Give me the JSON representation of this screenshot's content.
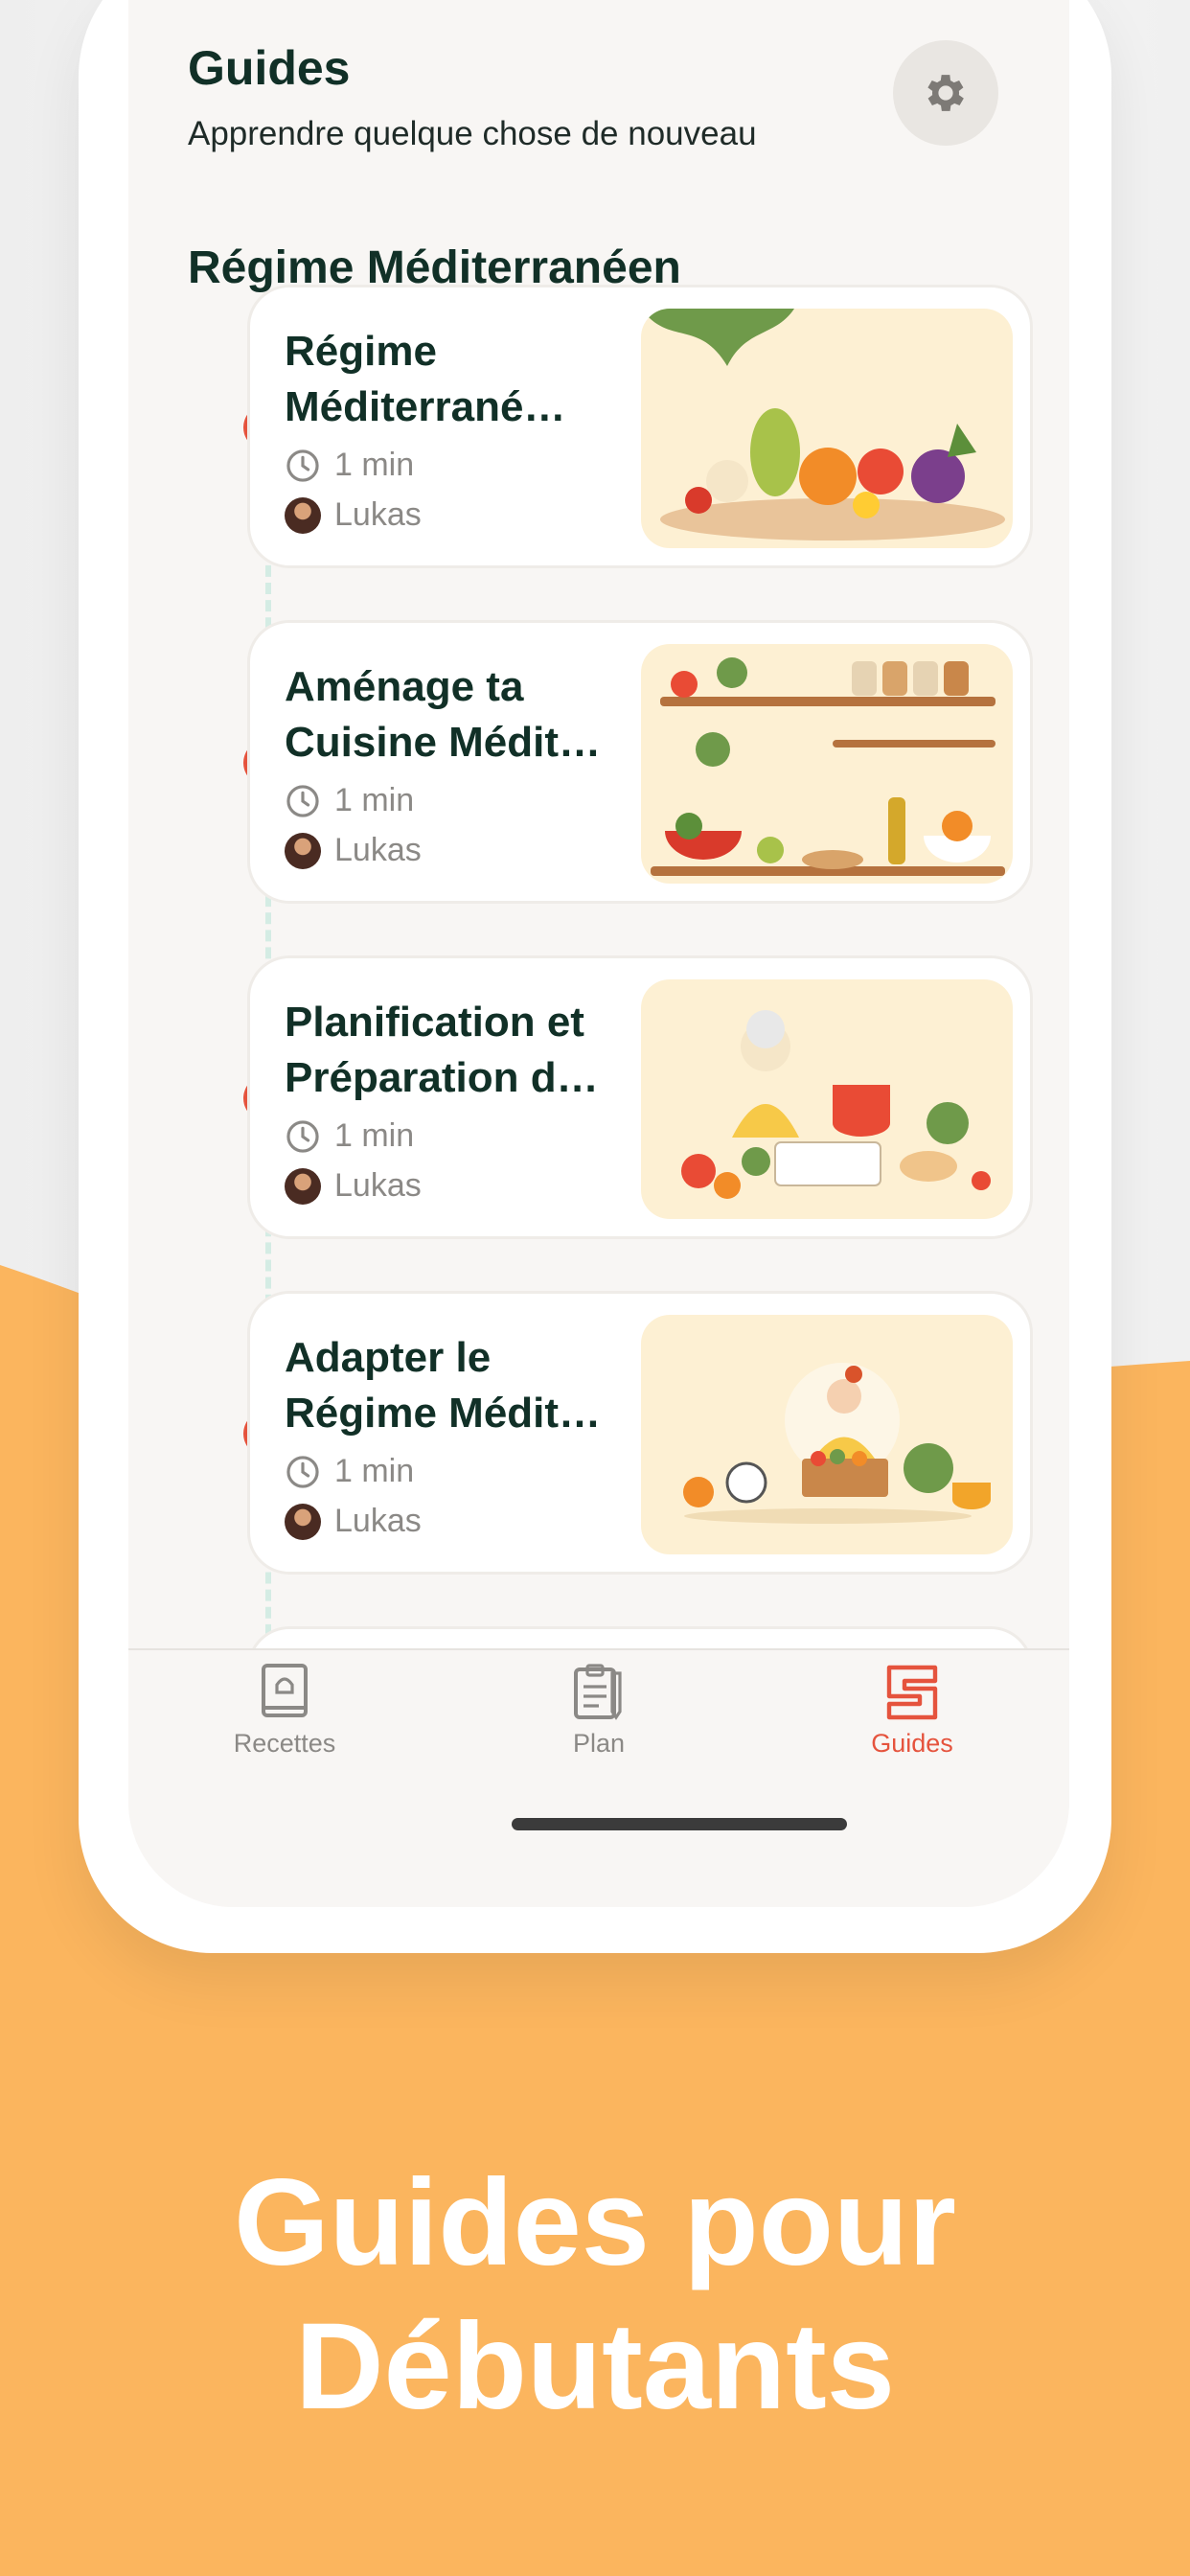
{
  "header": {
    "title": "Guides",
    "subtitle": "Apprendre quelque chose de nouveau"
  },
  "section": {
    "title": "Régime Méditerranéen"
  },
  "cards": [
    {
      "title_line1": "Régime",
      "title_line2": "Méditerrané…",
      "duration": "1 min",
      "author": "Lukas",
      "completed": true
    },
    {
      "title_line1": "Aménage ta",
      "title_line2": "Cuisine Médit…",
      "duration": "1 min",
      "author": "Lukas",
      "completed": true
    },
    {
      "title_line1": "Planification et",
      "title_line2": "Préparation d…",
      "duration": "1 min",
      "author": "Lukas",
      "completed": true
    },
    {
      "title_line1": "Adapter le",
      "title_line2": "Régime Médit…",
      "duration": "1 min",
      "author": "Lukas",
      "completed": true
    }
  ],
  "tabs": [
    {
      "label": "Recettes",
      "icon": "cookbook-icon",
      "active": false
    },
    {
      "label": "Plan",
      "icon": "plan-clipboard-icon",
      "active": false
    },
    {
      "label": "Guides",
      "icon": "guides-logo-icon",
      "active": true
    }
  ],
  "promo": {
    "line1": "Guides pour",
    "line2": "Débutants"
  },
  "colors": {
    "accent": "#e5533d",
    "promo_orange": "#fbb55e",
    "title_dark": "#113027"
  }
}
